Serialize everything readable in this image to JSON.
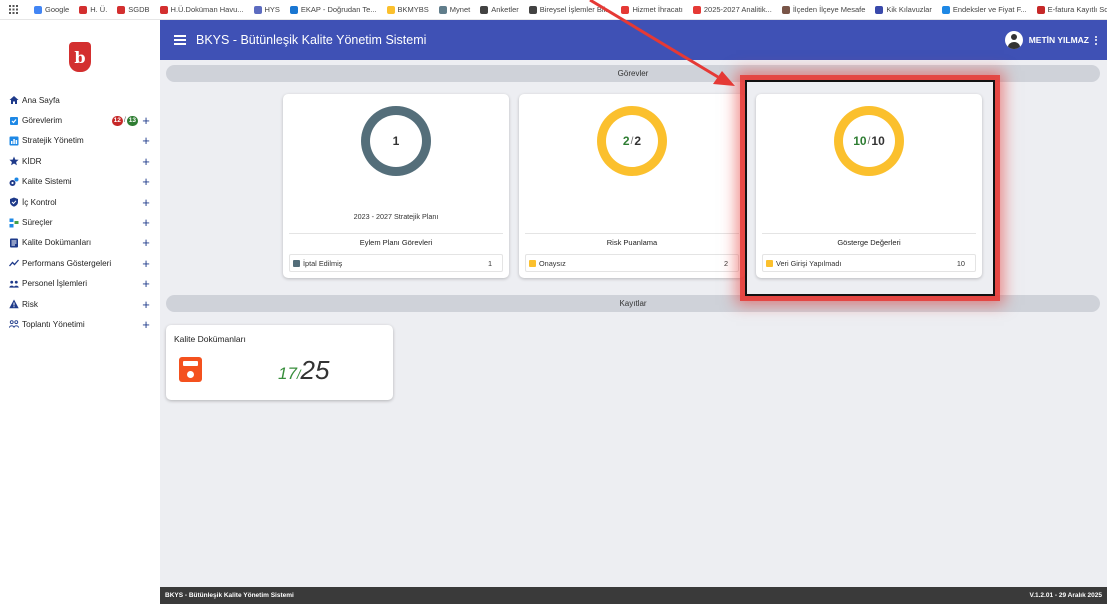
{
  "bookmarks": [
    {
      "label": "Google",
      "color": "#4285f4"
    },
    {
      "label": "H. Ü.",
      "color": "#d32f2f"
    },
    {
      "label": "SGDB",
      "color": "#d32f2f"
    },
    {
      "label": "H.Ü.Doküman Havu...",
      "color": "#d32f2f"
    },
    {
      "label": "HYS",
      "color": "#5c6bc0"
    },
    {
      "label": "EKAP - Doğrudan Te...",
      "color": "#1976d2"
    },
    {
      "label": "BKMYBS",
      "color": "#fbc02d"
    },
    {
      "label": "Mynet",
      "color": "#607d8b"
    },
    {
      "label": "Anketler",
      "color": "#424242"
    },
    {
      "label": "Bireysel İşlemler Bil...",
      "color": "#424242"
    },
    {
      "label": "Hizmet İhracatı",
      "color": "#e53935"
    },
    {
      "label": "2025-2027 Analitik...",
      "color": "#e53935"
    },
    {
      "label": "İlçeden İlçeye Mesafe",
      "color": "#795548"
    },
    {
      "label": "Kik Kılavuzlar",
      "color": "#3949ab"
    },
    {
      "label": "Endeksler ve Fiyat F...",
      "color": "#1e88e5"
    },
    {
      "label": "E-fatura Kayıtlı Sorg...",
      "color": "#c62828"
    }
  ],
  "bookmarks_more": "»",
  "logo_glyph": "b",
  "app": {
    "title": "BKYS - Bütünleşik Kalite Yönetim Sistemi",
    "user": "METİN YILMAZ"
  },
  "sidebar": {
    "items": [
      {
        "label": "Ana Sayfa",
        "icon": "home-icon",
        "color": "#1e3a8a",
        "plus": false
      },
      {
        "label": "Görevlerim",
        "icon": "task-icon",
        "color": "#1e88e5",
        "plus": true,
        "badges": {
          "left": "12",
          "sep": "/",
          "right": "13"
        }
      },
      {
        "label": "Stratejik Yönetim",
        "icon": "chart-icon",
        "color": "#1e88e5",
        "plus": true
      },
      {
        "label": "KİDR",
        "icon": "star-icon",
        "color": "#1e3a8a",
        "plus": true
      },
      {
        "label": "Kalite Sistemi",
        "icon": "gears-icon",
        "color": "#1e3a8a",
        "plus": true
      },
      {
        "label": "İç Kontrol",
        "icon": "shield-icon",
        "color": "#1e3a8a",
        "plus": true
      },
      {
        "label": "Süreçler",
        "icon": "process-icon",
        "color": "#1e88e5",
        "plus": true
      },
      {
        "label": "Kalite Dokümanları",
        "icon": "document-icon",
        "color": "#1e3a8a",
        "plus": true
      },
      {
        "label": "Performans Göstergeleri",
        "icon": "trend-icon",
        "color": "#1e3a8a",
        "plus": true
      },
      {
        "label": "Personel İşlemleri",
        "icon": "people-icon",
        "color": "#1e3a8a",
        "plus": true
      },
      {
        "label": "Risk",
        "icon": "warning-icon",
        "color": "#1e3a8a",
        "plus": true
      },
      {
        "label": "Toplantı Yönetimi",
        "icon": "meeting-icon",
        "color": "#1e3a8a",
        "plus": true
      }
    ],
    "plus_symbol": "+"
  },
  "sections": {
    "tasks": "Görevler",
    "records": "Kayıtlar"
  },
  "cards": [
    {
      "value": "1",
      "done": null,
      "total": "1",
      "ring_color": "#546e7a",
      "progress": 1.0,
      "plan": "2023 - 2027 Stratejik Planı",
      "title": "Eylem Planı Görevleri",
      "row_label": "İptal Edilmiş",
      "row_value": "1",
      "row_color": "#546e7a"
    },
    {
      "value": null,
      "done": "2",
      "total": "2",
      "ring_color": "#fbc02d",
      "progress": 1.0,
      "plan": "",
      "title": "Risk Puanlama",
      "row_label": "Onaysız",
      "row_value": "2",
      "row_color": "#fbc02d"
    },
    {
      "value": null,
      "done": "10",
      "total": "10",
      "ring_color": "#fbc02d",
      "progress": 1.0,
      "plan": "",
      "title": "Gösterge Değerleri",
      "row_label": "Veri Girişi Yapılmadı",
      "row_value": "10",
      "row_color": "#fbc02d"
    }
  ],
  "records": {
    "title": "Kalite Dokümanları",
    "done": "17",
    "sep": "/",
    "total": "25",
    "icon": "save-icon",
    "icon_color": "#f4511e"
  },
  "footer": {
    "left": "BKYS - Bütünleşik Kalite Yönetim Sistemi",
    "right": "V.1.2.01 - 29 Aralık 2025"
  },
  "annotation": {
    "arrow_color": "#e53935"
  }
}
